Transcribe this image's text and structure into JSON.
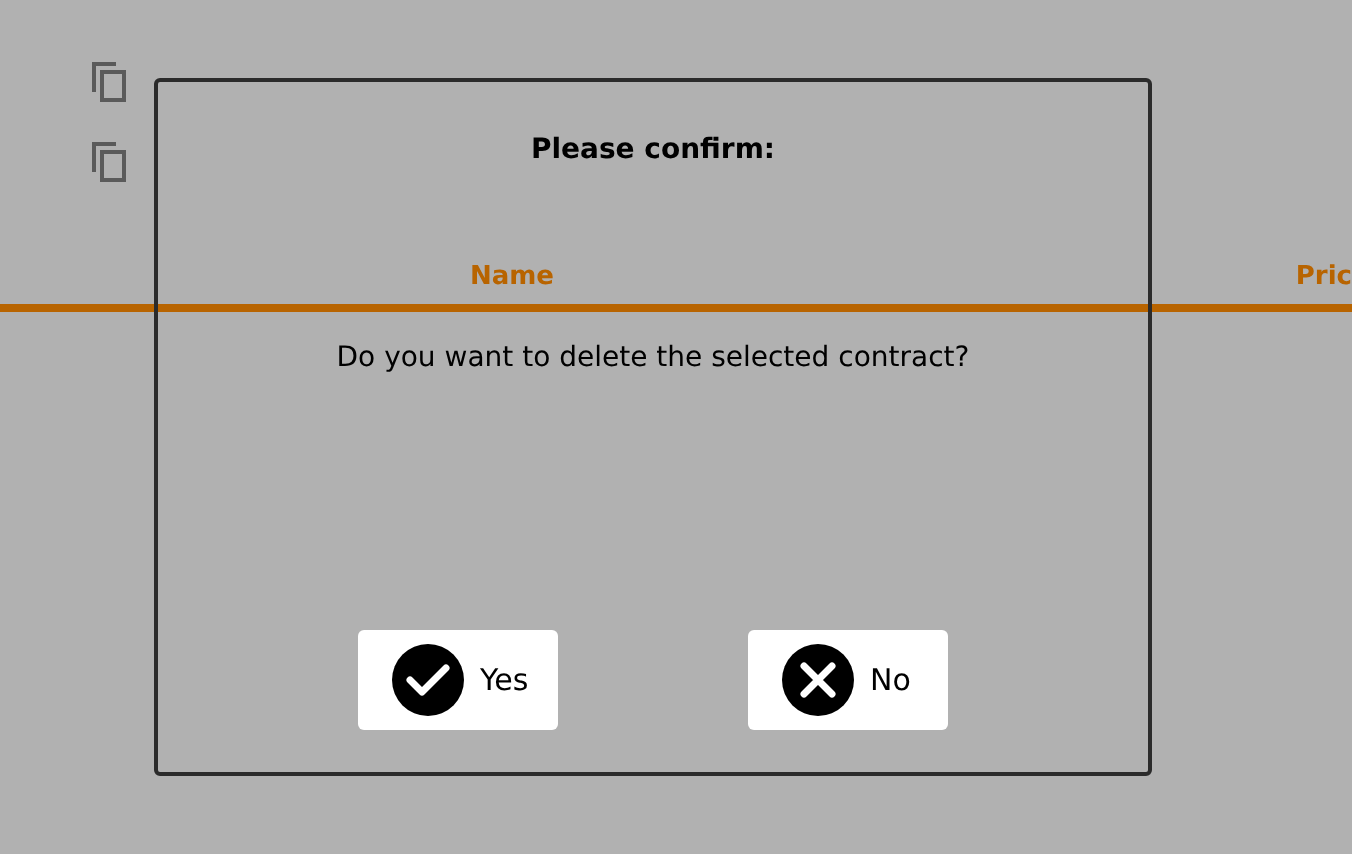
{
  "background": {
    "row_actions": [
      {
        "kind": "copy"
      },
      {
        "kind": "copy"
      }
    ],
    "columns": [
      "Name",
      "Pric"
    ]
  },
  "dialog": {
    "title": "Please confirm:",
    "message": "Do you want to delete the selected contract?",
    "buttons": [
      {
        "kind": "confirm",
        "label": "Yes"
      },
      {
        "kind": "cancel",
        "label": "No"
      }
    ]
  }
}
